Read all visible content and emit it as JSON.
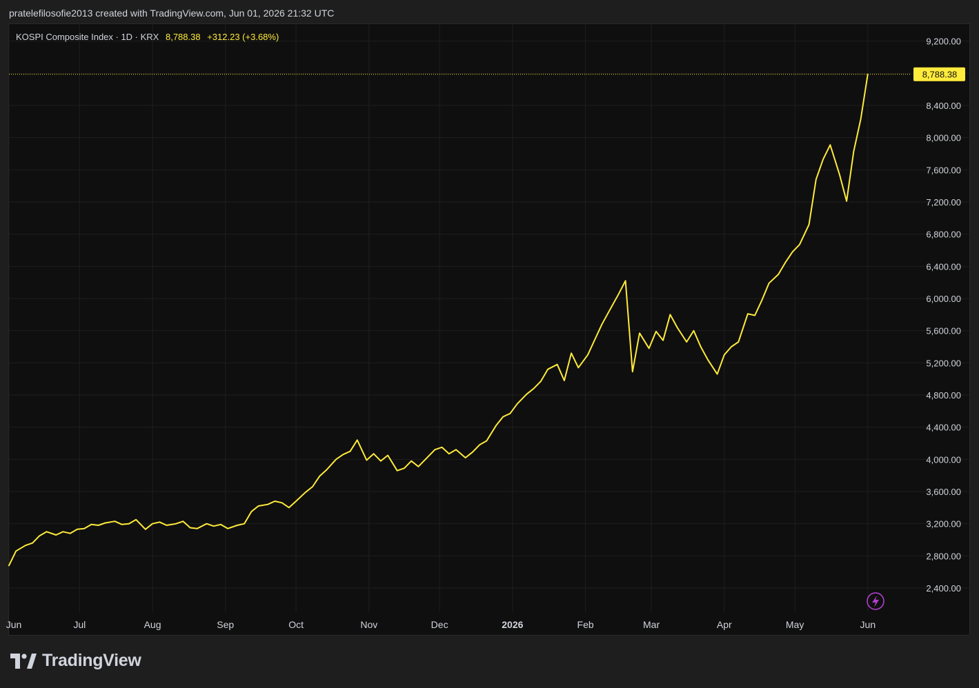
{
  "header": {
    "credit": "pratelefilosofie2013 created with TradingView.com, Jun 01, 2026 21:32 UTC"
  },
  "legend": {
    "symbol": "KOSPI Composite Index · 1D · KRX",
    "last": "8,788.38",
    "change": "+312.23 (+3.68%)"
  },
  "brand": {
    "name": "TradingView",
    "logo_icon": "tradingview-logo-icon"
  },
  "colors": {
    "line": "#ffeb3b",
    "background": "#0f0f0f",
    "grid": "#1f1f1f",
    "text": "#d1d4dc",
    "accent_icon": "#b23fd1"
  },
  "icons": {
    "flash": "lightning-bolt-icon"
  },
  "chart_data": {
    "type": "line",
    "title": "",
    "xlabel": "",
    "ylabel": "",
    "y_axis_position": "right",
    "ylim": [
      2100,
      9420
    ],
    "last_value": 8788.38,
    "last_value_label": "8,788.38",
    "grid": true,
    "y_ticks": [
      2400,
      2800,
      3200,
      3600,
      4000,
      4400,
      4800,
      5200,
      5600,
      6000,
      6400,
      6800,
      7200,
      7600,
      8000,
      8400,
      8800,
      9200
    ],
    "y_tick_labels": [
      "2,400.00",
      "2,800.00",
      "3,200.00",
      "3,600.00",
      "4,000.00",
      "4,400.00",
      "4,800.00",
      "5,200.00",
      "5,600.00",
      "6,000.00",
      "6,400.00",
      "6,800.00",
      "7,200.00",
      "7,600.00",
      "8,000.00",
      "8,400.00",
      "",
      "9,200.00"
    ],
    "x_range": [
      "2025-06-01",
      "2026-06-16"
    ],
    "x_ticks": [
      {
        "date": "2025-06-01",
        "label": "Jun",
        "bold": false
      },
      {
        "date": "2025-07-01",
        "label": "Jul",
        "bold": false
      },
      {
        "date": "2025-08-01",
        "label": "Aug",
        "bold": false
      },
      {
        "date": "2025-09-01",
        "label": "Sep",
        "bold": false
      },
      {
        "date": "2025-10-01",
        "label": "Oct",
        "bold": false
      },
      {
        "date": "2025-11-01",
        "label": "Nov",
        "bold": false
      },
      {
        "date": "2025-12-01",
        "label": "Dec",
        "bold": false
      },
      {
        "date": "2026-01-01",
        "label": "2026",
        "bold": true
      },
      {
        "date": "2026-02-01",
        "label": "Feb",
        "bold": false
      },
      {
        "date": "2026-03-01",
        "label": "Mar",
        "bold": false
      },
      {
        "date": "2026-04-01",
        "label": "Apr",
        "bold": false
      },
      {
        "date": "2026-05-01",
        "label": "May",
        "bold": false
      },
      {
        "date": "2026-06-01",
        "label": "Jun",
        "bold": false
      }
    ],
    "series": [
      {
        "x": [
          "2025-06-01",
          "2025-06-04",
          "2025-06-08",
          "2025-06-11",
          "2025-06-14",
          "2025-06-17",
          "2025-06-21",
          "2025-06-24",
          "2025-06-27",
          "2025-06-30",
          "2025-07-03",
          "2025-07-06",
          "2025-07-09",
          "2025-07-12",
          "2025-07-16",
          "2025-07-19",
          "2025-07-22",
          "2025-07-25",
          "2025-07-29",
          "2025-08-01",
          "2025-08-04",
          "2025-08-07",
          "2025-08-11",
          "2025-08-14",
          "2025-08-17",
          "2025-08-20",
          "2025-08-24",
          "2025-08-27",
          "2025-08-30",
          "2025-09-02",
          "2025-09-06",
          "2025-09-09",
          "2025-09-12",
          "2025-09-15",
          "2025-09-19",
          "2025-09-22",
          "2025-09-25",
          "2025-09-28",
          "2025-10-01",
          "2025-10-05",
          "2025-10-08",
          "2025-10-11",
          "2025-10-14",
          "2025-10-18",
          "2025-10-21",
          "2025-10-24",
          "2025-10-27",
          "2025-10-31",
          "2025-11-03",
          "2025-11-06",
          "2025-11-09",
          "2025-11-13",
          "2025-11-16",
          "2025-11-19",
          "2025-11-22",
          "2025-11-26",
          "2025-11-29",
          "2025-12-02",
          "2025-12-05",
          "2025-12-08",
          "2025-12-12",
          "2025-12-15",
          "2025-12-18",
          "2025-12-21",
          "2025-12-25",
          "2025-12-28",
          "2025-12-31",
          "2026-01-03",
          "2026-01-07",
          "2026-01-10",
          "2026-01-13",
          "2026-01-16",
          "2026-01-20",
          "2026-01-23",
          "2026-01-26",
          "2026-01-29",
          "2026-02-02",
          "2026-02-05",
          "2026-02-08",
          "2026-02-11",
          "2026-02-15",
          "2026-02-18",
          "2026-02-21",
          "2026-02-24",
          "2026-02-28",
          "2026-03-03",
          "2026-03-06",
          "2026-03-09",
          "2026-03-12",
          "2026-03-16",
          "2026-03-19",
          "2026-03-22",
          "2026-03-25",
          "2026-03-29",
          "2026-04-01",
          "2026-04-04",
          "2026-04-07",
          "2026-04-11",
          "2026-04-14",
          "2026-04-17",
          "2026-04-20",
          "2026-04-24",
          "2026-04-27",
          "2026-04-30",
          "2026-05-03",
          "2026-05-07",
          "2026-05-10",
          "2026-05-13",
          "2026-05-16",
          "2026-05-20",
          "2026-05-23",
          "2026-05-26",
          "2026-05-29",
          "2026-06-01"
        ],
        "values": [
          2680,
          2860,
          2930,
          2960,
          3050,
          3100,
          3060,
          3100,
          3080,
          3130,
          3140,
          3190,
          3180,
          3210,
          3230,
          3190,
          3200,
          3250,
          3130,
          3200,
          3220,
          3180,
          3200,
          3230,
          3150,
          3140,
          3200,
          3170,
          3190,
          3140,
          3180,
          3200,
          3350,
          3420,
          3440,
          3480,
          3460,
          3400,
          3480,
          3590,
          3660,
          3790,
          3870,
          4000,
          4060,
          4100,
          4240,
          3990,
          4070,
          3980,
          4050,
          3860,
          3890,
          3980,
          3910,
          4030,
          4120,
          4150,
          4070,
          4120,
          4020,
          4090,
          4180,
          4230,
          4420,
          4530,
          4570,
          4690,
          4810,
          4880,
          4970,
          5120,
          5180,
          4980,
          5320,
          5140,
          5300,
          5490,
          5680,
          5840,
          6050,
          6220,
          5090,
          5570,
          5380,
          5590,
          5480,
          5800,
          5640,
          5460,
          5600,
          5400,
          5240,
          5060,
          5300,
          5400,
          5460,
          5810,
          5790,
          5980,
          6190,
          6300,
          6450,
          6580,
          6670,
          6920,
          7480,
          7730,
          7910,
          7540,
          7210,
          7830,
          8230,
          8788.38
        ],
        "color": "#ffeb3b"
      }
    ]
  }
}
